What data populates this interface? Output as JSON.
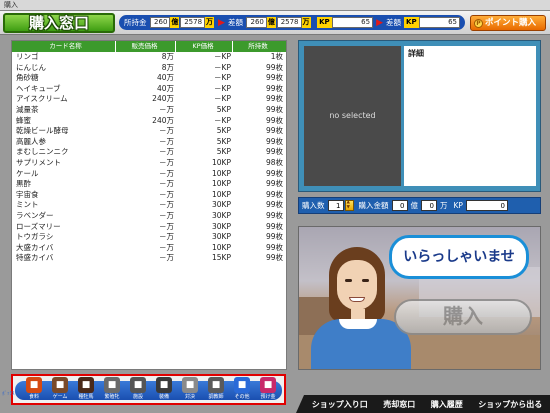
{
  "window": {
    "title": "購入"
  },
  "header": {
    "page_title": "購入窓口",
    "status": {
      "money_label": "所持金",
      "money_oku": "260",
      "money_oku_unit": "億",
      "money_man": "2578",
      "money_man_unit": "万",
      "diff_label": "差額",
      "diff_oku": "260",
      "diff_oku_unit": "億",
      "diff_man": "2578",
      "diff_man_unit": "万",
      "kp_unit": "KP",
      "kp_value": "65",
      "kp_diff_label": "差額",
      "kp_diff_unit": "KP",
      "kp_diff_value": "65"
    },
    "point_purchase_label": "ポイント購入"
  },
  "card_list": {
    "columns": [
      "カード名称",
      "販売価格",
      "KP価格",
      "所持数"
    ],
    "rows": [
      [
        "リンゴ",
        "8万",
        "－KP",
        "1枚"
      ],
      [
        "にんじん",
        "8万",
        "－KP",
        "99枚"
      ],
      [
        "角砂糖",
        "40万",
        "－KP",
        "99枚"
      ],
      [
        "ヘイキューブ",
        "40万",
        "－KP",
        "99枚"
      ],
      [
        "アイスクリーム",
        "240万",
        "－KP",
        "99枚"
      ],
      [
        "減量茶",
        "－万",
        "5KP",
        "99枚"
      ],
      [
        "蜂蜜",
        "240万",
        "－KP",
        "99枚"
      ],
      [
        "乾燥ビール酵母",
        "－万",
        "5KP",
        "99枚"
      ],
      [
        "高麗人参",
        "－万",
        "5KP",
        "99枚"
      ],
      [
        "まむしニンニク",
        "－万",
        "5KP",
        "99枚"
      ],
      [
        "サプリメント",
        "－万",
        "10KP",
        "98枚"
      ],
      [
        "ケール",
        "－万",
        "10KP",
        "99枚"
      ],
      [
        "黒酢",
        "－万",
        "10KP",
        "99枚"
      ],
      [
        "宇宙食",
        "－万",
        "10KP",
        "99枚"
      ],
      [
        "ミント",
        "－万",
        "30KP",
        "99枚"
      ],
      [
        "ラベンダー",
        "－万",
        "30KP",
        "99枚"
      ],
      [
        "ローズマリー",
        "－万",
        "30KP",
        "99枚"
      ],
      [
        "トウガラシ",
        "－万",
        "30KP",
        "99枚"
      ],
      [
        "大盛カイバ",
        "－万",
        "10KP",
        "99枚"
      ],
      [
        "特盛カイバ",
        "－万",
        "15KP",
        "99枚"
      ]
    ]
  },
  "detail": {
    "preview_placeholder": "no selected",
    "title": "詳細"
  },
  "purchase": {
    "qty_label": "購入数",
    "qty_value": "1",
    "amount_label": "購入金額",
    "amount_oku": "0",
    "amount_oku_unit": "億",
    "amount_man": "0",
    "amount_man_unit": "万",
    "kp_unit": "KP",
    "kp_value": "0"
  },
  "scene": {
    "greeting": "いらっしゃいませ",
    "buy_label": "購入"
  },
  "categories": [
    {
      "label": "食料",
      "icon": "carrot-icon",
      "color": "#d64a12"
    },
    {
      "label": "ゲーム",
      "icon": "horse-icon",
      "color": "#7a4a2a"
    },
    {
      "label": "種牡馬",
      "icon": "stallion-icon",
      "color": "#4a2a1a"
    },
    {
      "label": "繁殖牝",
      "icon": "mare-icon",
      "color": "#6a6a6a"
    },
    {
      "label": "施設",
      "icon": "facility-icon",
      "color": "#555555"
    },
    {
      "label": "装備",
      "icon": "equipment-icon",
      "color": "#3a3a3a"
    },
    {
      "label": "対決",
      "icon": "versus-icon",
      "color": "#8a8a8a"
    },
    {
      "label": "調教師",
      "icon": "trainer-icon",
      "color": "#5a5a5a"
    },
    {
      "label": "その他",
      "icon": "cards-icon",
      "color": "#2a6ad8"
    },
    {
      "label": "預け金",
      "icon": "deposit-icon",
      "color": "#c82a6a"
    }
  ],
  "left_edge_label": "ﾎﾞｯｸｽ",
  "bottom_nav": [
    "ショップ入り口",
    "売却窓口",
    "購入履歴",
    "ショップから出る"
  ]
}
